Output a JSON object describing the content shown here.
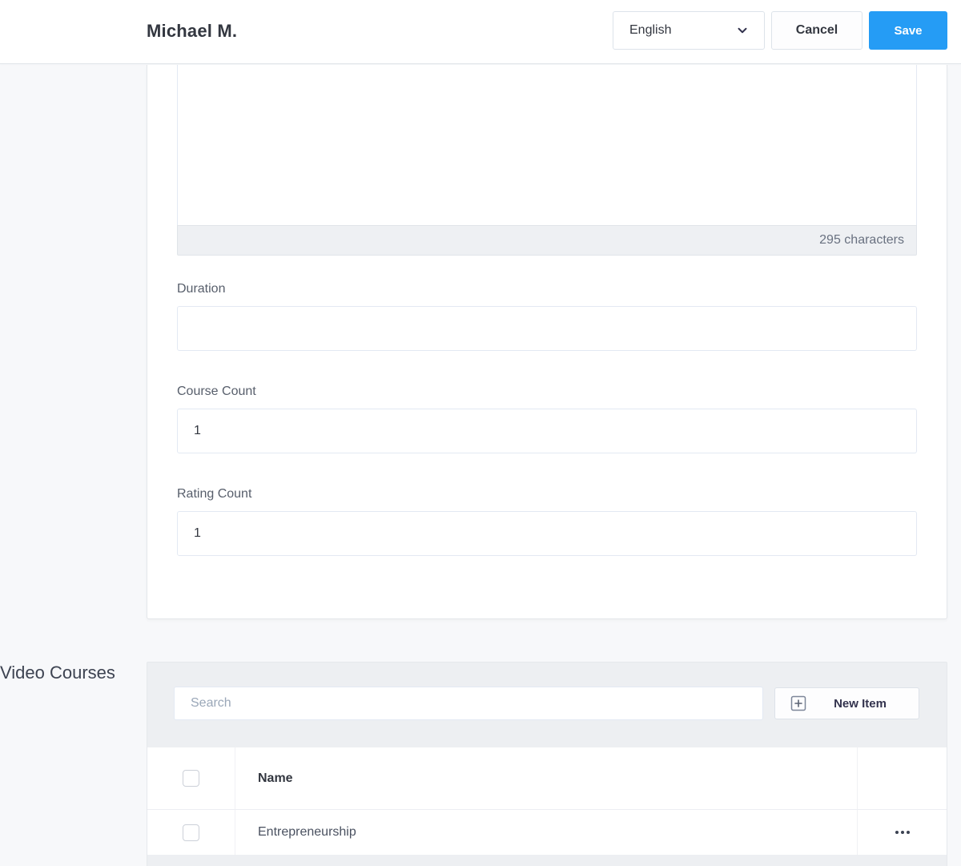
{
  "header": {
    "title": "Michael M.",
    "language": {
      "selected": "English"
    },
    "cancel_label": "Cancel",
    "save_label": "Save"
  },
  "form": {
    "description": {
      "value": "",
      "counter": "295 characters"
    },
    "fields": [
      {
        "label": "Duration",
        "value": ""
      },
      {
        "label": "Course Count",
        "value": "1"
      },
      {
        "label": "Rating Count",
        "value": "1"
      }
    ]
  },
  "video_courses": {
    "title": "Video Courses",
    "search": {
      "placeholder": "Search",
      "value": ""
    },
    "new_item_label": "New Item",
    "table": {
      "columns": [
        {
          "label": "Name"
        }
      ],
      "rows": [
        {
          "name": "Entrepreneurship"
        }
      ]
    }
  },
  "icons": {
    "language_chevron": "chevron-down-icon",
    "new_item": "plus-square-icon",
    "row_actions": "ellipsis-icon"
  },
  "colors": {
    "accent_blue": "#259cf5",
    "page_background": "#f7f8fa",
    "card_background": "#ffffff",
    "relation_card_background": "#edeff2",
    "counter_bar_background": "#eef0f3"
  }
}
